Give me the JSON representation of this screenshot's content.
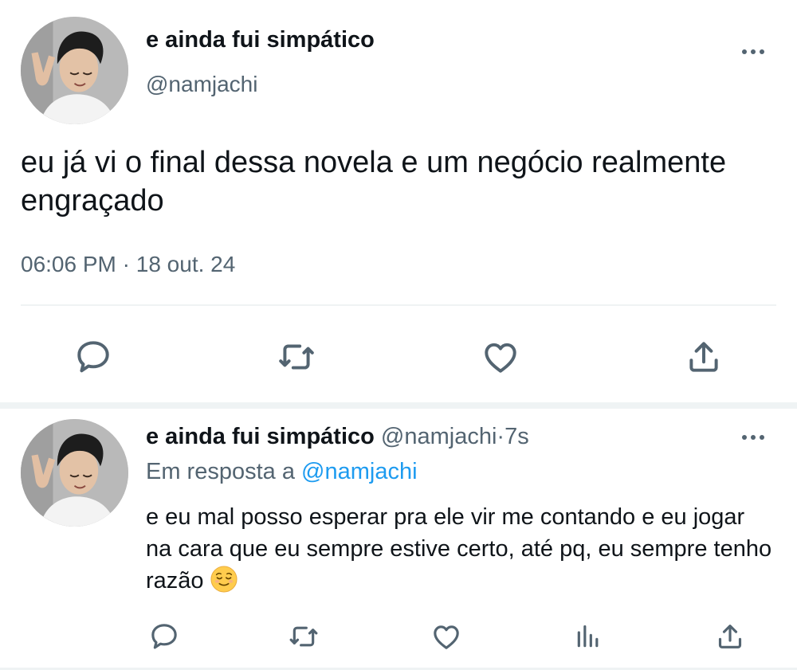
{
  "main_tweet": {
    "display_name": "e ainda fui simpático",
    "handle": "@namjachi",
    "text": "eu já vi o final dessa novela e um negócio realmente engraçado",
    "time": "06:06 PM",
    "separator": "·",
    "date": "18 out. 24",
    "actions": [
      "reply-icon",
      "retweet-icon",
      "like-icon",
      "share-icon"
    ]
  },
  "reply_tweet": {
    "display_name": "e ainda fui simpático",
    "handle": "@namjachi",
    "separator": "·",
    "time": "7s",
    "reply_prefix": "Em resposta a",
    "reply_mention": "@namjachi",
    "text": "e eu mal posso esperar pra ele vir me contando e eu jogar na cara que eu sempre estive certo, até pq, eu sempre tenho razão",
    "emoji": "relieved-face-emoji",
    "actions": [
      "reply-icon",
      "retweet-icon",
      "like-icon",
      "analytics-icon",
      "share-icon"
    ]
  },
  "colors": {
    "text": "#0f1419",
    "secondary": "#536471",
    "mention": "#1d9bf0",
    "divider": "#eff3f4"
  }
}
